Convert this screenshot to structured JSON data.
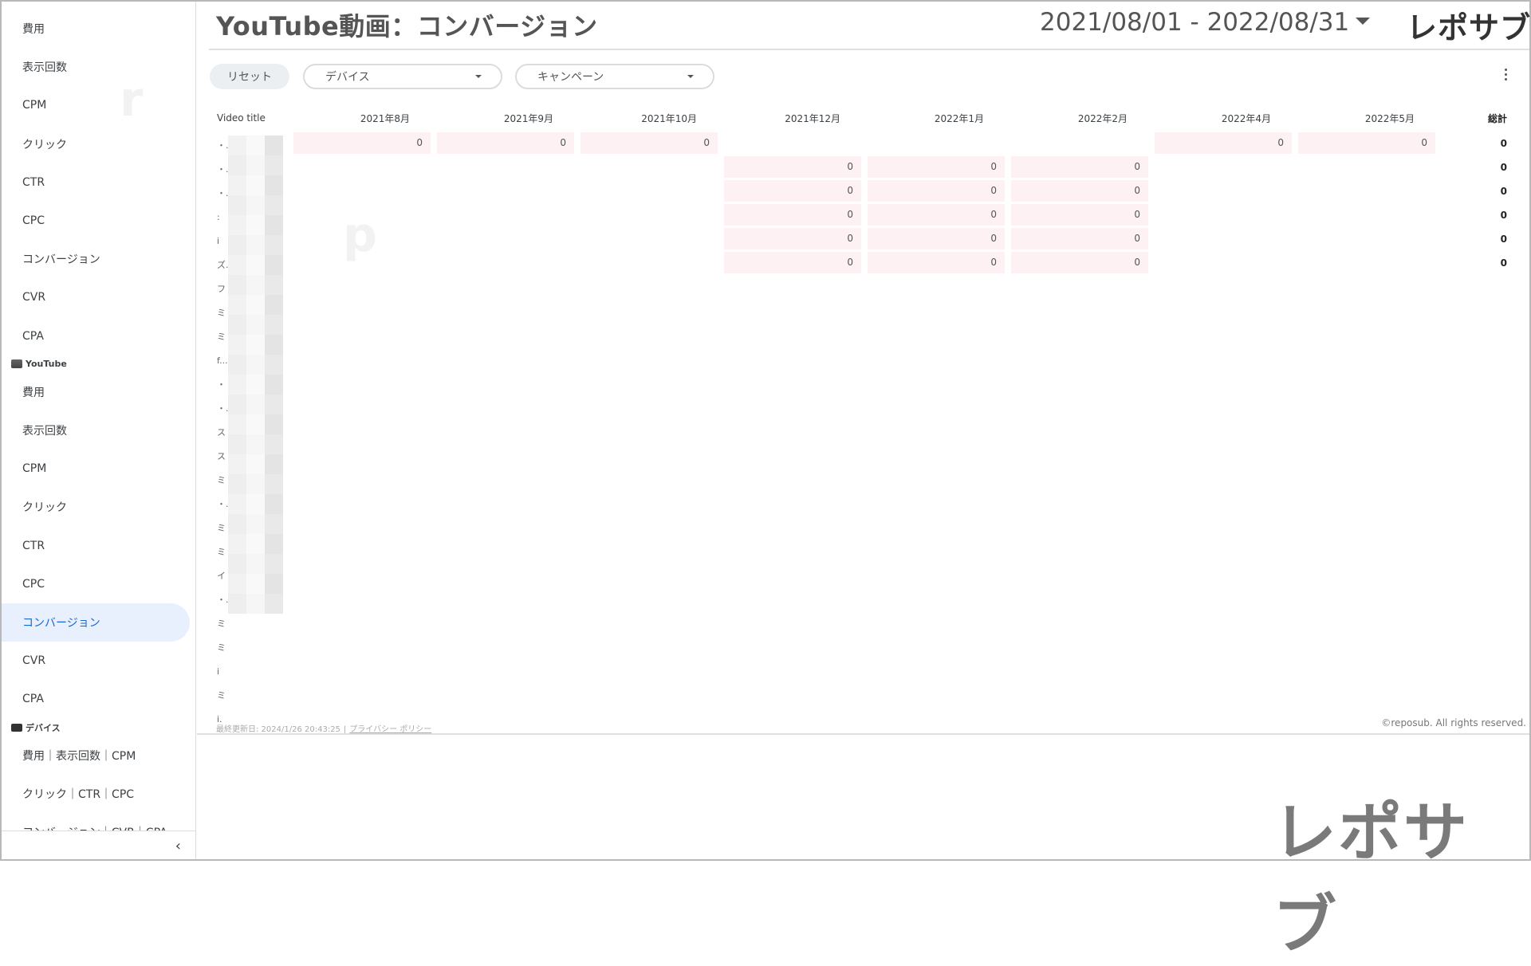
{
  "sidebar": {
    "items_top": [
      "費用",
      "表示回数",
      "CPM",
      "クリック",
      "CTR",
      "CPC",
      "コンバージョン",
      "CVR",
      "CPA"
    ],
    "section_youtube": "YouTube",
    "items_youtube": [
      "費用",
      "表示回数",
      "CPM",
      "クリック",
      "CTR",
      "CPC",
      "コンバージョン",
      "CVR",
      "CPA"
    ],
    "active_item": "コンバージョン",
    "section_device": "デバイス",
    "items_device": [
      "費用｜表示回数｜CPM",
      "クリック｜CTR｜CPC",
      "コンバージョン｜CVR｜CPA"
    ],
    "collapse_icon": "chevron-left-icon"
  },
  "header": {
    "title": "YouTube動画：コンバージョン",
    "date_range": "2021/08/01 - 2022/08/31",
    "brand": "レポサブ"
  },
  "controls": {
    "reset": "リセット",
    "device_filter": "デバイス",
    "campaign_filter": "キャンペーン"
  },
  "table": {
    "title_header": "Video title",
    "columns": [
      "2021年8月",
      "2021年9月",
      "2021年10月",
      "2021年12月",
      "2022年1月",
      "2022年2月",
      "2022年4月",
      "2022年5月"
    ],
    "total_header": "総計",
    "rows": [
      {
        "cells": [
          "0",
          "0",
          "0",
          "",
          "",
          "",
          "0",
          "0"
        ],
        "total": "0"
      },
      {
        "cells": [
          "",
          "",
          "",
          "0",
          "0",
          "0",
          "",
          ""
        ],
        "total": "0"
      },
      {
        "cells": [
          "",
          "",
          "",
          "0",
          "0",
          "0",
          "",
          ""
        ],
        "total": "0"
      },
      {
        "cells": [
          "",
          "",
          "",
          "0",
          "0",
          "0",
          "",
          ""
        ],
        "total": "0"
      },
      {
        "cells": [
          "",
          "",
          "",
          "0",
          "0",
          "0",
          "",
          ""
        ],
        "total": "0"
      },
      {
        "cells": [
          "",
          "",
          "",
          "0",
          "0",
          "0",
          "",
          ""
        ],
        "total": "0"
      }
    ],
    "row_stubs": [
      "・..",
      "・..",
      "・...",
      ":",
      "i",
      "ズ..",
      "フ",
      "ミ",
      "ミ",
      "f...",
      "・",
      "・.",
      "ス",
      "ス",
      "ミ",
      "・..",
      "ミ",
      "ミ",
      "イ",
      "・..",
      "ミ",
      "ミ",
      "i",
      "ミ",
      "i."
    ]
  },
  "footer": {
    "last_updated": "最終更新日: 2024/1/26 20:43:25",
    "separator": "|",
    "privacy": "プライバシー ポリシー",
    "copyright": "©reposub. All rights reserved.",
    "brand_big": "レポサブ"
  },
  "colors": {
    "active_bg": "#e8f0fe",
    "active_text": "#1967d2",
    "shade": "#fdf1f3"
  }
}
